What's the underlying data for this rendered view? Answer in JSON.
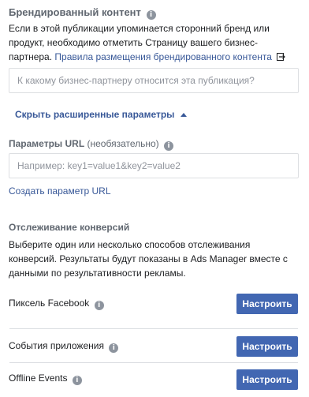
{
  "branded": {
    "title": "Брендированный контент",
    "description": "Если в этой публикации упоминается сторонний бренд или продукт, необходимо отметить Страницу вашего бизнес-партнера.",
    "link_label": "Правила размещения брендированного контента",
    "input_placeholder": "К какому бизнес-партнеру относится эта публикация?"
  },
  "advanced": {
    "toggle_label": "Скрыть расширенные параметры"
  },
  "url_params": {
    "title": "Параметры URL",
    "optional_label": "(необязательно)",
    "input_placeholder": "Например: key1=value1&key2=value2",
    "create_link": "Создать параметр URL"
  },
  "conversion": {
    "title": "Отслеживание конверсий",
    "description": "Выберите один или несколько способов отслеживания конверсий. Результаты будут показаны в Ads Manager вместе с данными по результативности рекламы.",
    "rows": [
      {
        "label": "Пиксель Facebook",
        "button": "Настроить"
      },
      {
        "label": "События приложения",
        "button": "Настроить"
      },
      {
        "label": "Offline Events",
        "button": "Настроить"
      }
    ]
  },
  "icons": {
    "info": "info-icon",
    "external_link": "external-link-icon",
    "caret_up": "caret-up-icon"
  },
  "colors": {
    "link": "#385898",
    "button": "#4267b2",
    "muted_title": "#606770"
  }
}
